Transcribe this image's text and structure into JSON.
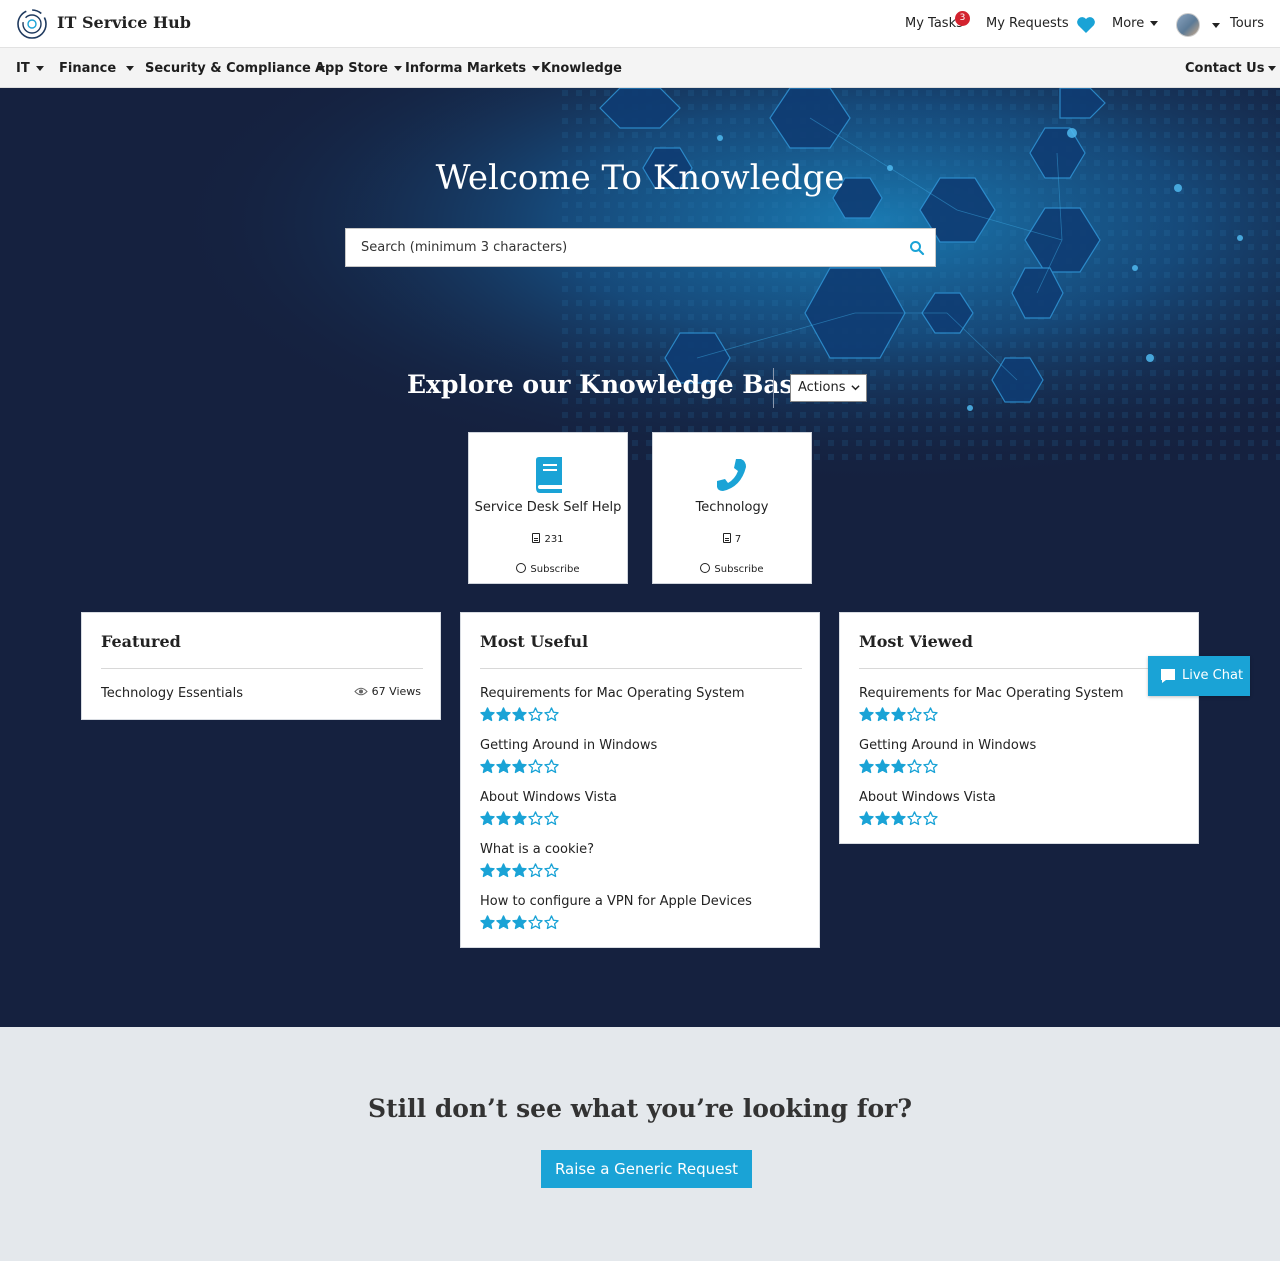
{
  "header": {
    "brand": "IT Service Hub",
    "my_tasks": "My Tasks",
    "tasks_badge": "3",
    "my_requests": "My Requests",
    "more": "More",
    "tours": "Tours"
  },
  "nav": {
    "items": [
      "IT",
      "Finance",
      "Security & Compliance",
      "App Store",
      "Informa Markets",
      "Knowledge"
    ],
    "contact": "Contact Us"
  },
  "hero": {
    "title": "Welcome To Knowledge",
    "search_placeholder": "Search (minimum 3 characters)"
  },
  "explore": {
    "title": "Explore our Knowledge Bases",
    "actions_label": "Actions"
  },
  "kb_cards": [
    {
      "title": "Service Desk Self Help",
      "count": "231",
      "subscribe": "Subscribe",
      "icon": "book-icon"
    },
    {
      "title": "Technology",
      "count": "7",
      "subscribe": "Subscribe",
      "icon": "phone-icon"
    }
  ],
  "featured": {
    "title": "Featured",
    "items": [
      {
        "label": "Technology Essentials",
        "views": "67 Views"
      }
    ]
  },
  "most_useful": {
    "title": "Most Useful",
    "items": [
      {
        "label": "Requirements for Mac Operating System",
        "rating": 3
      },
      {
        "label": "Getting Around in Windows",
        "rating": 3
      },
      {
        "label": "About Windows Vista",
        "rating": 3
      },
      {
        "label": "What is a cookie?",
        "rating": 3
      },
      {
        "label": "How to configure a VPN for Apple Devices",
        "rating": 3
      }
    ]
  },
  "most_viewed": {
    "title": "Most Viewed",
    "items": [
      {
        "label": "Requirements for Mac Operating System",
        "rating": 3
      },
      {
        "label": "Getting Around in Windows",
        "rating": 3
      },
      {
        "label": "About Windows Vista",
        "rating": 3
      }
    ]
  },
  "live_chat": "Live Chat",
  "footer": {
    "question": "Still don’t see what you’re looking for?",
    "button": "Raise a Generic Request"
  },
  "colors": {
    "accent": "#1aa3d6",
    "hero_bg": "#15213f",
    "badge": "#d3232f"
  }
}
